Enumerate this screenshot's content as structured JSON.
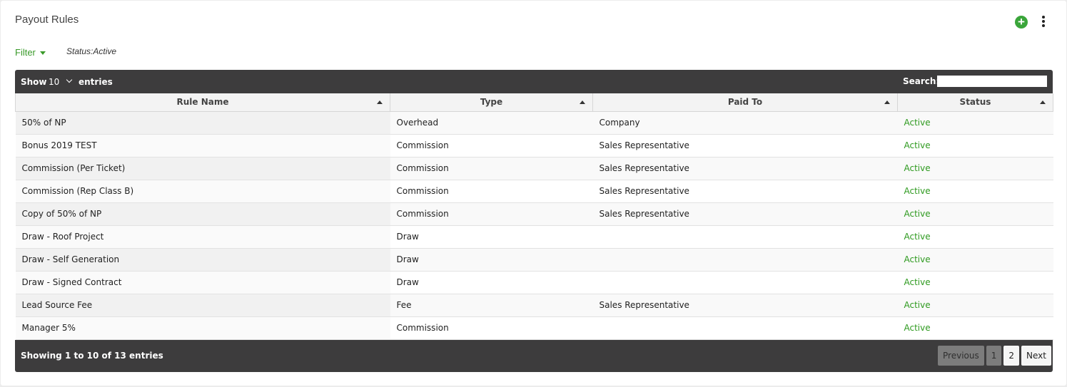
{
  "page": {
    "title": "Payout Rules"
  },
  "filter": {
    "label": "Filter",
    "active": "Status:Active"
  },
  "table_controls": {
    "show_label": "Show",
    "length_value": "10",
    "entries_label": "entries",
    "search_label": "Search:",
    "search_value": ""
  },
  "columns": [
    "Rule Name",
    "Type",
    "Paid To",
    "Status"
  ],
  "rows": [
    [
      "50% of NP",
      "Overhead",
      "Company",
      "Active"
    ],
    [
      "Bonus 2019 TEST",
      "Commission",
      "Sales Representative",
      "Active"
    ],
    [
      "Commission (Per Ticket)",
      "Commission",
      "Sales Representative",
      "Active"
    ],
    [
      "Commission (Rep Class B)",
      "Commission",
      "Sales Representative",
      "Active"
    ],
    [
      "Copy of 50% of NP",
      "Commission",
      "Sales Representative",
      "Active"
    ],
    [
      "Draw - Roof Project",
      "Draw",
      "",
      "Active"
    ],
    [
      "Draw - Self Generation",
      "Draw",
      "",
      "Active"
    ],
    [
      "Draw - Signed Contract",
      "Draw",
      "",
      "Active"
    ],
    [
      "Lead Source Fee",
      "Fee",
      "Sales Representative",
      "Active"
    ],
    [
      "Manager 5%",
      "Commission",
      "",
      "Active"
    ]
  ],
  "footer": {
    "info": "Showing 1 to 10 of 13 entries",
    "previous": "Previous",
    "pages": [
      "1",
      "2"
    ],
    "next": "Next"
  },
  "colors": {
    "accent": "#3a9a2a",
    "bar": "#3d3c3d",
    "add_button": "#3aa53a"
  },
  "icons": {
    "add": "plus-circle-icon",
    "menu": "kebab-vertical-icon",
    "sort": "sort-asc-icon"
  }
}
